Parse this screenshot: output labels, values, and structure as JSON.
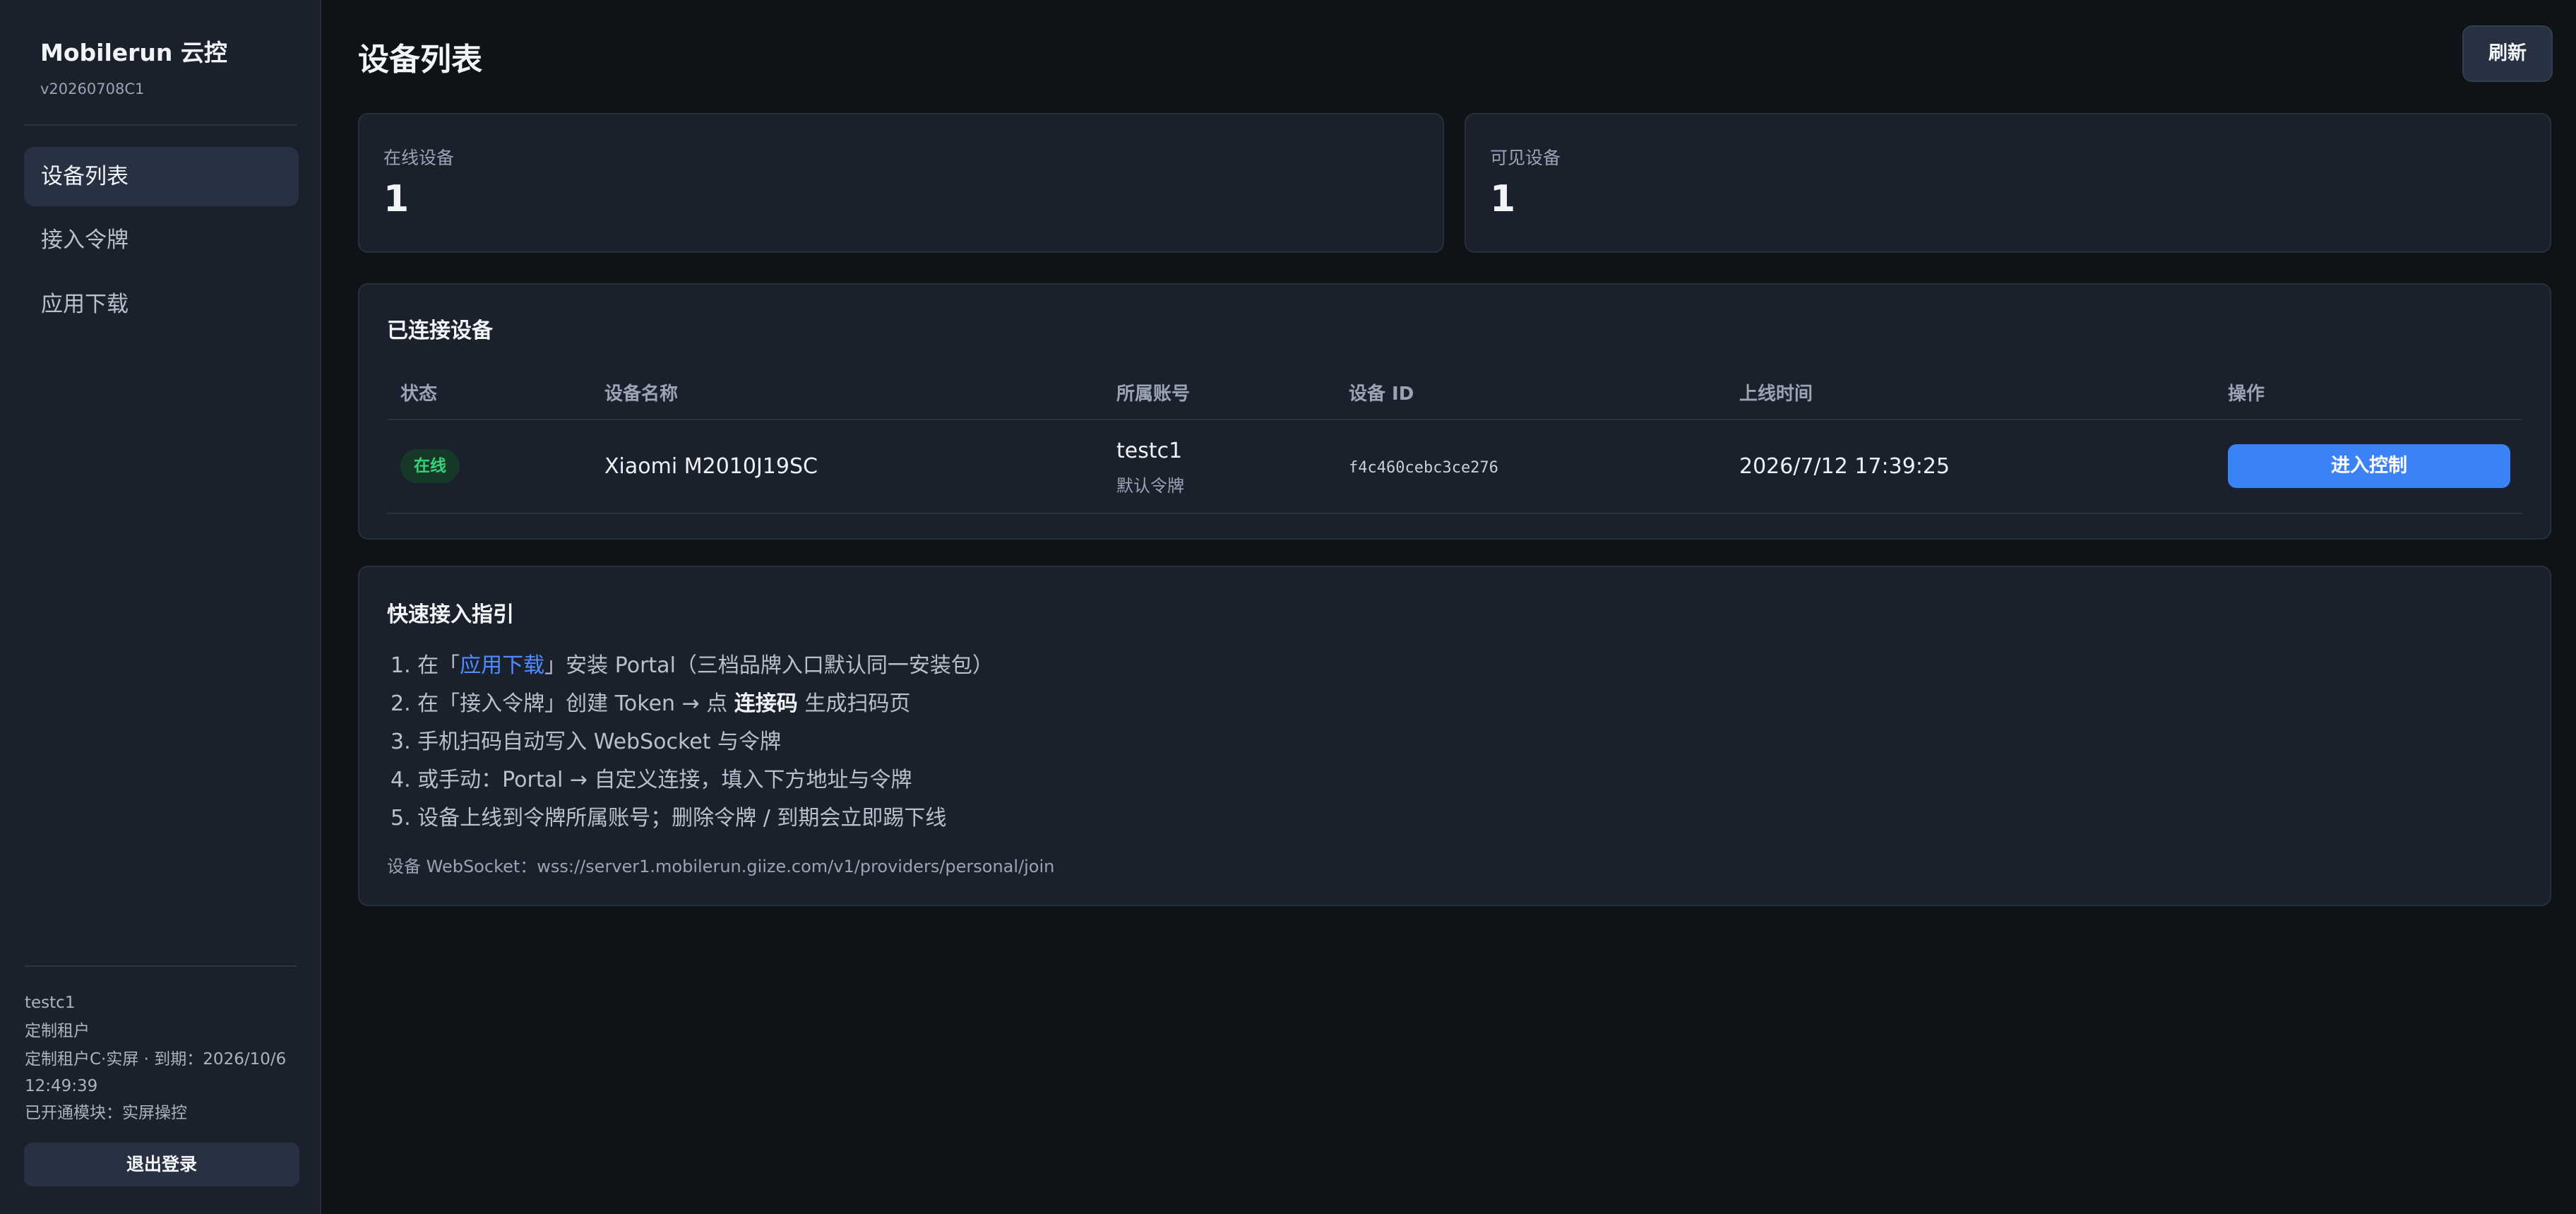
{
  "sidebar": {
    "brand_title": "Mobilerun 云控",
    "version": "v20260708C1",
    "items": [
      {
        "label": "设备列表",
        "active": true
      },
      {
        "label": "接入令牌",
        "active": false
      },
      {
        "label": "应用下载",
        "active": false
      }
    ],
    "user": {
      "name": "testc1",
      "tenant": "定制租户",
      "expire_line1": "定制租户C·实屏 · 到期：2026/10/6",
      "expire_line2": "12:49:39",
      "modules": "已开通模块：实屏操控"
    },
    "logout_label": "退出登录"
  },
  "header": {
    "title": "设备列表",
    "refresh_label": "刷新"
  },
  "stats": [
    {
      "label": "在线设备",
      "value": "1"
    },
    {
      "label": "可见设备",
      "value": "1"
    }
  ],
  "devices": {
    "title": "已连接设备",
    "columns": [
      "状态",
      "设备名称",
      "所属账号",
      "设备 ID",
      "上线时间",
      "操作"
    ],
    "rows": [
      {
        "status": "在线",
        "name": "Xiaomi M2010J19SC",
        "account": "testc1",
        "account_sub": "默认令牌",
        "device_id": "f4c460cebc3ce276",
        "online_time": "2026/7/12 17:39:25",
        "action_label": "进入控制"
      }
    ]
  },
  "guide": {
    "title": "快速接入指引",
    "step1": {
      "prefix": "1. 在「",
      "link": "应用下载",
      "suffix": "」安装 Portal（三档品牌入口默认同一安装包）"
    },
    "step2": {
      "prefix": "2. 在「接入令牌」创建 Token → 点 ",
      "bold": "连接码",
      "suffix": " 生成扫码页"
    },
    "step3": "3. 手机扫码自动写入 WebSocket 与令牌",
    "step4": "4. 或手动：Portal → 自定义连接，填入下方地址与令牌",
    "step5": "5. 设备上线到令牌所属账号；删除令牌 / 到期会立即踢下线",
    "ws_label": "设备 WebSocket：wss://server1.mobilerun.giize.com/v1/providers/personal/join"
  },
  "colors": {
    "accent": "#3b82f6",
    "online_green": "#34d27a",
    "link_blue": "#4d8dff"
  }
}
